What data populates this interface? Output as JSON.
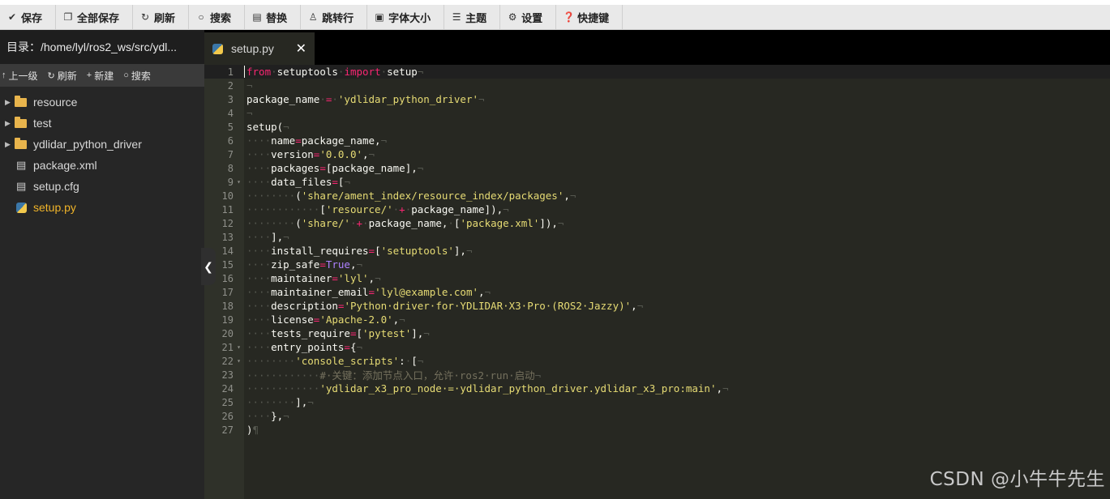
{
  "toolbar": {
    "buttons": [
      {
        "icon": "check-icon",
        "glyph": "✔",
        "label": "保存"
      },
      {
        "icon": "copy-icon",
        "glyph": "❐",
        "label": "全部保存"
      },
      {
        "icon": "refresh-icon",
        "glyph": "↻",
        "label": "刷新"
      },
      {
        "icon": "search-icon",
        "glyph": "○",
        "label": "搜索"
      },
      {
        "icon": "replace-icon",
        "glyph": "▤",
        "label": "替换"
      },
      {
        "icon": "goto-line-icon",
        "glyph": "♙",
        "label": "跳转行"
      },
      {
        "icon": "font-size-icon",
        "glyph": "▣",
        "label": "字体大小"
      },
      {
        "icon": "theme-icon",
        "glyph": "☰",
        "label": "主题"
      },
      {
        "icon": "gear-icon",
        "glyph": "⚙",
        "label": "设置"
      },
      {
        "icon": "help-icon",
        "glyph": "❓",
        "label": "快捷键"
      }
    ]
  },
  "sidebar": {
    "directory": "目录：/home/lyl/ros2_ws/src/ydl...",
    "actions": [
      {
        "icon": "arrow-up-icon",
        "glyph": "↑",
        "label": "上一级"
      },
      {
        "icon": "refresh-icon",
        "glyph": "↻",
        "label": "刷新"
      },
      {
        "icon": "plus-icon",
        "glyph": "+",
        "label": "新建"
      },
      {
        "icon": "search-icon",
        "glyph": "○",
        "label": "搜索"
      }
    ],
    "tree": [
      {
        "type": "folder",
        "name": "resource"
      },
      {
        "type": "folder",
        "name": "test"
      },
      {
        "type": "folder",
        "name": "ydlidar_python_driver"
      },
      {
        "type": "file",
        "name": "package.xml"
      },
      {
        "type": "file",
        "name": "setup.cfg"
      },
      {
        "type": "python",
        "name": "setup.py",
        "active": true
      }
    ]
  },
  "tab": {
    "title": "setup.py",
    "close": "✕"
  },
  "editor": {
    "lines": [
      {
        "n": "1",
        "fold": "",
        "tokens": [
          [
            "kw",
            "from"
          ],
          [
            "inv",
            "·"
          ],
          [
            "",
            "setuptools"
          ],
          [
            "inv",
            "·"
          ],
          [
            "kw",
            "import"
          ],
          [
            "inv",
            "·"
          ],
          [
            "",
            "setup"
          ],
          [
            "inv",
            "¬"
          ]
        ]
      },
      {
        "n": "2",
        "fold": "",
        "tokens": [
          [
            "inv",
            "¬"
          ]
        ]
      },
      {
        "n": "3",
        "fold": "",
        "tokens": [
          [
            "",
            "package_name"
          ],
          [
            "inv",
            "·"
          ],
          [
            "op",
            "="
          ],
          [
            "inv",
            "·"
          ],
          [
            "str",
            "'ydlidar_python_driver'"
          ],
          [
            "inv",
            "¬"
          ]
        ]
      },
      {
        "n": "4",
        "fold": "",
        "tokens": [
          [
            "inv",
            "¬"
          ]
        ]
      },
      {
        "n": "5",
        "fold": "",
        "tokens": [
          [
            "",
            "setup("
          ],
          [
            "inv",
            "¬"
          ]
        ]
      },
      {
        "n": "6",
        "fold": "",
        "tokens": [
          [
            "inv",
            "····"
          ],
          [
            "",
            "name"
          ],
          [
            "op",
            "="
          ],
          [
            "",
            "package_name,"
          ],
          [
            "inv",
            "¬"
          ]
        ]
      },
      {
        "n": "7",
        "fold": "",
        "tokens": [
          [
            "inv",
            "····"
          ],
          [
            "",
            "version"
          ],
          [
            "op",
            "="
          ],
          [
            "str",
            "'0.0.0'"
          ],
          [
            "",
            ","
          ],
          [
            "inv",
            "¬"
          ]
        ]
      },
      {
        "n": "8",
        "fold": "",
        "tokens": [
          [
            "inv",
            "····"
          ],
          [
            "",
            "packages"
          ],
          [
            "op",
            "="
          ],
          [
            "",
            "[package_name],"
          ],
          [
            "inv",
            "¬"
          ]
        ]
      },
      {
        "n": "9",
        "fold": "▾",
        "tokens": [
          [
            "inv",
            "····"
          ],
          [
            "",
            "data_files"
          ],
          [
            "op",
            "="
          ],
          [
            "",
            "["
          ],
          [
            "inv",
            "¬"
          ]
        ]
      },
      {
        "n": "10",
        "fold": "",
        "tokens": [
          [
            "inv",
            "········"
          ],
          [
            "",
            "("
          ],
          [
            "str",
            "'share/ament_index/resource_index/packages'"
          ],
          [
            "",
            ","
          ],
          [
            "inv",
            "¬"
          ]
        ]
      },
      {
        "n": "11",
        "fold": "",
        "tokens": [
          [
            "inv",
            "············"
          ],
          [
            "",
            "["
          ],
          [
            "str",
            "'resource/'"
          ],
          [
            "inv",
            "·"
          ],
          [
            "op",
            "+"
          ],
          [
            "inv",
            "·"
          ],
          [
            "",
            "package_name]),"
          ],
          [
            "inv",
            "¬"
          ]
        ]
      },
      {
        "n": "12",
        "fold": "",
        "tokens": [
          [
            "inv",
            "········"
          ],
          [
            "",
            "("
          ],
          [
            "str",
            "'share/'"
          ],
          [
            "inv",
            "·"
          ],
          [
            "op",
            "+"
          ],
          [
            "inv",
            "·"
          ],
          [
            "",
            "package_name,"
          ],
          [
            "inv",
            "·"
          ],
          [
            "",
            "["
          ],
          [
            "str",
            "'package.xml'"
          ],
          [
            "",
            "]),"
          ],
          [
            "inv",
            "¬"
          ]
        ]
      },
      {
        "n": "13",
        "fold": "",
        "tokens": [
          [
            "inv",
            "····"
          ],
          [
            "",
            "],"
          ],
          [
            "inv",
            "¬"
          ]
        ]
      },
      {
        "n": "14",
        "fold": "",
        "tokens": [
          [
            "inv",
            "····"
          ],
          [
            "",
            "install_requires"
          ],
          [
            "op",
            "="
          ],
          [
            "",
            "["
          ],
          [
            "str",
            "'setuptools'"
          ],
          [
            "",
            "],"
          ],
          [
            "inv",
            "¬"
          ]
        ]
      },
      {
        "n": "15",
        "fold": "",
        "tokens": [
          [
            "inv",
            "····"
          ],
          [
            "",
            "zip_safe"
          ],
          [
            "op",
            "="
          ],
          [
            "const",
            "True"
          ],
          [
            "",
            ","
          ],
          [
            "inv",
            "¬"
          ]
        ]
      },
      {
        "n": "16",
        "fold": "",
        "tokens": [
          [
            "inv",
            "····"
          ],
          [
            "",
            "maintainer"
          ],
          [
            "op",
            "="
          ],
          [
            "str",
            "'lyl'"
          ],
          [
            "",
            ","
          ],
          [
            "inv",
            "¬"
          ]
        ]
      },
      {
        "n": "17",
        "fold": "",
        "tokens": [
          [
            "inv",
            "····"
          ],
          [
            "",
            "maintainer_email"
          ],
          [
            "op",
            "="
          ],
          [
            "str",
            "'lyl@example.com'"
          ],
          [
            "",
            ","
          ],
          [
            "inv",
            "¬"
          ]
        ]
      },
      {
        "n": "18",
        "fold": "",
        "tokens": [
          [
            "inv",
            "····"
          ],
          [
            "",
            "description"
          ],
          [
            "op",
            "="
          ],
          [
            "str",
            "'Python·driver·for·YDLIDAR·X3·Pro·(ROS2·Jazzy)'"
          ],
          [
            "",
            ","
          ],
          [
            "inv",
            "¬"
          ]
        ]
      },
      {
        "n": "19",
        "fold": "",
        "tokens": [
          [
            "inv",
            "····"
          ],
          [
            "",
            "license"
          ],
          [
            "op",
            "="
          ],
          [
            "str",
            "'Apache-2.0'"
          ],
          [
            "",
            ","
          ],
          [
            "inv",
            "¬"
          ]
        ]
      },
      {
        "n": "20",
        "fold": "",
        "tokens": [
          [
            "inv",
            "····"
          ],
          [
            "",
            "tests_require"
          ],
          [
            "op",
            "="
          ],
          [
            "",
            "["
          ],
          [
            "str",
            "'pytest'"
          ],
          [
            "",
            "],"
          ],
          [
            "inv",
            "¬"
          ]
        ]
      },
      {
        "n": "21",
        "fold": "▾",
        "tokens": [
          [
            "inv",
            "····"
          ],
          [
            "",
            "entry_points"
          ],
          [
            "op",
            "="
          ],
          [
            "",
            "{"
          ],
          [
            "inv",
            "¬"
          ]
        ]
      },
      {
        "n": "22",
        "fold": "▾",
        "tokens": [
          [
            "inv",
            "········"
          ],
          [
            "str",
            "'console_scripts'"
          ],
          [
            "",
            ":"
          ],
          [
            "inv",
            "·"
          ],
          [
            "",
            "["
          ],
          [
            "inv",
            "¬"
          ]
        ]
      },
      {
        "n": "23",
        "fold": "",
        "tokens": [
          [
            "inv",
            "············"
          ],
          [
            "cmt",
            "#·关键：添加节点入口，允许·ros2·run·启动"
          ],
          [
            "inv",
            "¬"
          ]
        ]
      },
      {
        "n": "24",
        "fold": "",
        "tokens": [
          [
            "inv",
            "············"
          ],
          [
            "str",
            "'ydlidar_x3_pro_node·=·ydlidar_python_driver.ydlidar_x3_pro:main'"
          ],
          [
            "",
            ","
          ],
          [
            "inv",
            "¬"
          ]
        ]
      },
      {
        "n": "25",
        "fold": "",
        "tokens": [
          [
            "inv",
            "········"
          ],
          [
            "",
            "],"
          ],
          [
            "inv",
            "¬"
          ]
        ]
      },
      {
        "n": "26",
        "fold": "",
        "tokens": [
          [
            "inv",
            "····"
          ],
          [
            "",
            "},"
          ],
          [
            "inv",
            "¬"
          ]
        ]
      },
      {
        "n": "27",
        "fold": "",
        "tokens": [
          [
            "",
            ")"
          ],
          [
            "inv",
            "¶"
          ]
        ]
      }
    ]
  },
  "watermark": "CSDN @小牛牛先生"
}
